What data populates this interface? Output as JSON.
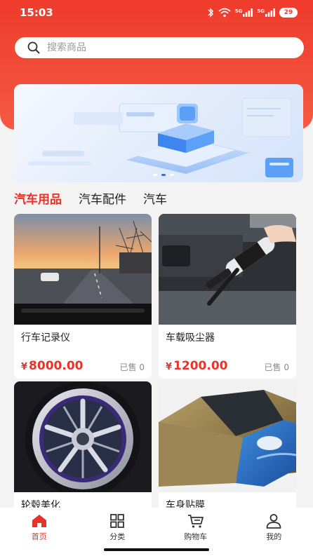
{
  "status_bar": {
    "time": "15:03",
    "signal_1": "5G",
    "signal_2": "5G",
    "battery": "29"
  },
  "search": {
    "placeholder": "搜索商品"
  },
  "banner": {
    "slides": 3,
    "active_slide": 2,
    "image": "car-accessory-illustration"
  },
  "tabs": [
    {
      "label": "汽车用品",
      "active": true
    },
    {
      "label": "汽车配件",
      "active": false
    },
    {
      "label": "汽车",
      "active": false
    }
  ],
  "products": [
    {
      "name": "行车记录仪",
      "currency": "¥",
      "price": "8000.00",
      "sold": "已售 0",
      "image": "dashcam-road-view"
    },
    {
      "name": "车载吸尘器",
      "currency": "¥",
      "price": "1200.00",
      "sold": "已售 0",
      "image": "car-vacuum"
    },
    {
      "name": "轮毂美化",
      "image": "chrome-wheel-rim"
    },
    {
      "name": "车身贴膜",
      "image": "gold-wrapped-car"
    }
  ],
  "tabbar": [
    {
      "label": "首页",
      "icon": "home-icon",
      "active": true
    },
    {
      "label": "分类",
      "icon": "grid-icon",
      "active": false
    },
    {
      "label": "购物车",
      "icon": "cart-icon",
      "active": false
    },
    {
      "label": "我的",
      "icon": "user-icon",
      "active": false
    }
  ],
  "colors": {
    "accent": "#e8332a",
    "header": "#ef3b2c"
  }
}
